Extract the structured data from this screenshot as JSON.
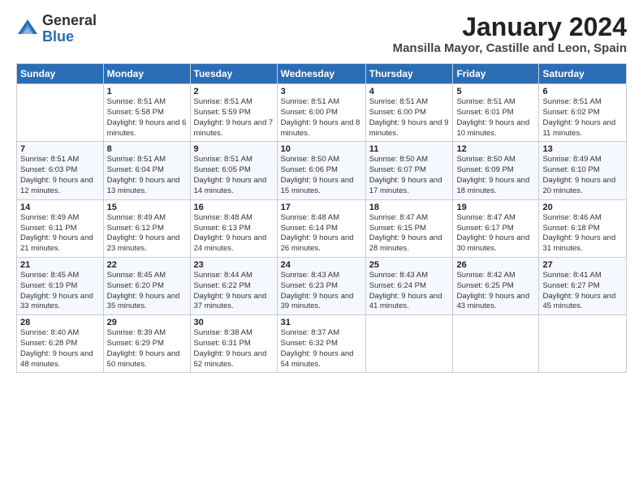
{
  "logo": {
    "general": "General",
    "blue": "Blue"
  },
  "title": "January 2024",
  "subtitle": "Mansilla Mayor, Castille and Leon, Spain",
  "days_header": [
    "Sunday",
    "Monday",
    "Tuesday",
    "Wednesday",
    "Thursday",
    "Friday",
    "Saturday"
  ],
  "weeks": [
    [
      {
        "day": "",
        "sunrise": "",
        "sunset": "",
        "daylight": ""
      },
      {
        "day": "1",
        "sunrise": "Sunrise: 8:51 AM",
        "sunset": "Sunset: 5:58 PM",
        "daylight": "Daylight: 9 hours and 6 minutes."
      },
      {
        "day": "2",
        "sunrise": "Sunrise: 8:51 AM",
        "sunset": "Sunset: 5:59 PM",
        "daylight": "Daylight: 9 hours and 7 minutes."
      },
      {
        "day": "3",
        "sunrise": "Sunrise: 8:51 AM",
        "sunset": "Sunset: 6:00 PM",
        "daylight": "Daylight: 9 hours and 8 minutes."
      },
      {
        "day": "4",
        "sunrise": "Sunrise: 8:51 AM",
        "sunset": "Sunset: 6:00 PM",
        "daylight": "Daylight: 9 hours and 9 minutes."
      },
      {
        "day": "5",
        "sunrise": "Sunrise: 8:51 AM",
        "sunset": "Sunset: 6:01 PM",
        "daylight": "Daylight: 9 hours and 10 minutes."
      },
      {
        "day": "6",
        "sunrise": "Sunrise: 8:51 AM",
        "sunset": "Sunset: 6:02 PM",
        "daylight": "Daylight: 9 hours and 11 minutes."
      }
    ],
    [
      {
        "day": "7",
        "sunrise": "Sunrise: 8:51 AM",
        "sunset": "Sunset: 6:03 PM",
        "daylight": "Daylight: 9 hours and 12 minutes."
      },
      {
        "day": "8",
        "sunrise": "Sunrise: 8:51 AM",
        "sunset": "Sunset: 6:04 PM",
        "daylight": "Daylight: 9 hours and 13 minutes."
      },
      {
        "day": "9",
        "sunrise": "Sunrise: 8:51 AM",
        "sunset": "Sunset: 6:05 PM",
        "daylight": "Daylight: 9 hours and 14 minutes."
      },
      {
        "day": "10",
        "sunrise": "Sunrise: 8:50 AM",
        "sunset": "Sunset: 6:06 PM",
        "daylight": "Daylight: 9 hours and 15 minutes."
      },
      {
        "day": "11",
        "sunrise": "Sunrise: 8:50 AM",
        "sunset": "Sunset: 6:07 PM",
        "daylight": "Daylight: 9 hours and 17 minutes."
      },
      {
        "day": "12",
        "sunrise": "Sunrise: 8:50 AM",
        "sunset": "Sunset: 6:09 PM",
        "daylight": "Daylight: 9 hours and 18 minutes."
      },
      {
        "day": "13",
        "sunrise": "Sunrise: 8:49 AM",
        "sunset": "Sunset: 6:10 PM",
        "daylight": "Daylight: 9 hours and 20 minutes."
      }
    ],
    [
      {
        "day": "14",
        "sunrise": "Sunrise: 8:49 AM",
        "sunset": "Sunset: 6:11 PM",
        "daylight": "Daylight: 9 hours and 21 minutes."
      },
      {
        "day": "15",
        "sunrise": "Sunrise: 8:49 AM",
        "sunset": "Sunset: 6:12 PM",
        "daylight": "Daylight: 9 hours and 23 minutes."
      },
      {
        "day": "16",
        "sunrise": "Sunrise: 8:48 AM",
        "sunset": "Sunset: 6:13 PM",
        "daylight": "Daylight: 9 hours and 24 minutes."
      },
      {
        "day": "17",
        "sunrise": "Sunrise: 8:48 AM",
        "sunset": "Sunset: 6:14 PM",
        "daylight": "Daylight: 9 hours and 26 minutes."
      },
      {
        "day": "18",
        "sunrise": "Sunrise: 8:47 AM",
        "sunset": "Sunset: 6:15 PM",
        "daylight": "Daylight: 9 hours and 28 minutes."
      },
      {
        "day": "19",
        "sunrise": "Sunrise: 8:47 AM",
        "sunset": "Sunset: 6:17 PM",
        "daylight": "Daylight: 9 hours and 30 minutes."
      },
      {
        "day": "20",
        "sunrise": "Sunrise: 8:46 AM",
        "sunset": "Sunset: 6:18 PM",
        "daylight": "Daylight: 9 hours and 31 minutes."
      }
    ],
    [
      {
        "day": "21",
        "sunrise": "Sunrise: 8:45 AM",
        "sunset": "Sunset: 6:19 PM",
        "daylight": "Daylight: 9 hours and 33 minutes."
      },
      {
        "day": "22",
        "sunrise": "Sunrise: 8:45 AM",
        "sunset": "Sunset: 6:20 PM",
        "daylight": "Daylight: 9 hours and 35 minutes."
      },
      {
        "day": "23",
        "sunrise": "Sunrise: 8:44 AM",
        "sunset": "Sunset: 6:22 PM",
        "daylight": "Daylight: 9 hours and 37 minutes."
      },
      {
        "day": "24",
        "sunrise": "Sunrise: 8:43 AM",
        "sunset": "Sunset: 6:23 PM",
        "daylight": "Daylight: 9 hours and 39 minutes."
      },
      {
        "day": "25",
        "sunrise": "Sunrise: 8:43 AM",
        "sunset": "Sunset: 6:24 PM",
        "daylight": "Daylight: 9 hours and 41 minutes."
      },
      {
        "day": "26",
        "sunrise": "Sunrise: 8:42 AM",
        "sunset": "Sunset: 6:25 PM",
        "daylight": "Daylight: 9 hours and 43 minutes."
      },
      {
        "day": "27",
        "sunrise": "Sunrise: 8:41 AM",
        "sunset": "Sunset: 6:27 PM",
        "daylight": "Daylight: 9 hours and 45 minutes."
      }
    ],
    [
      {
        "day": "28",
        "sunrise": "Sunrise: 8:40 AM",
        "sunset": "Sunset: 6:28 PM",
        "daylight": "Daylight: 9 hours and 48 minutes."
      },
      {
        "day": "29",
        "sunrise": "Sunrise: 8:39 AM",
        "sunset": "Sunset: 6:29 PM",
        "daylight": "Daylight: 9 hours and 50 minutes."
      },
      {
        "day": "30",
        "sunrise": "Sunrise: 8:38 AM",
        "sunset": "Sunset: 6:31 PM",
        "daylight": "Daylight: 9 hours and 52 minutes."
      },
      {
        "day": "31",
        "sunrise": "Sunrise: 8:37 AM",
        "sunset": "Sunset: 6:32 PM",
        "daylight": "Daylight: 9 hours and 54 minutes."
      },
      {
        "day": "",
        "sunrise": "",
        "sunset": "",
        "daylight": ""
      },
      {
        "day": "",
        "sunrise": "",
        "sunset": "",
        "daylight": ""
      },
      {
        "day": "",
        "sunrise": "",
        "sunset": "",
        "daylight": ""
      }
    ]
  ]
}
